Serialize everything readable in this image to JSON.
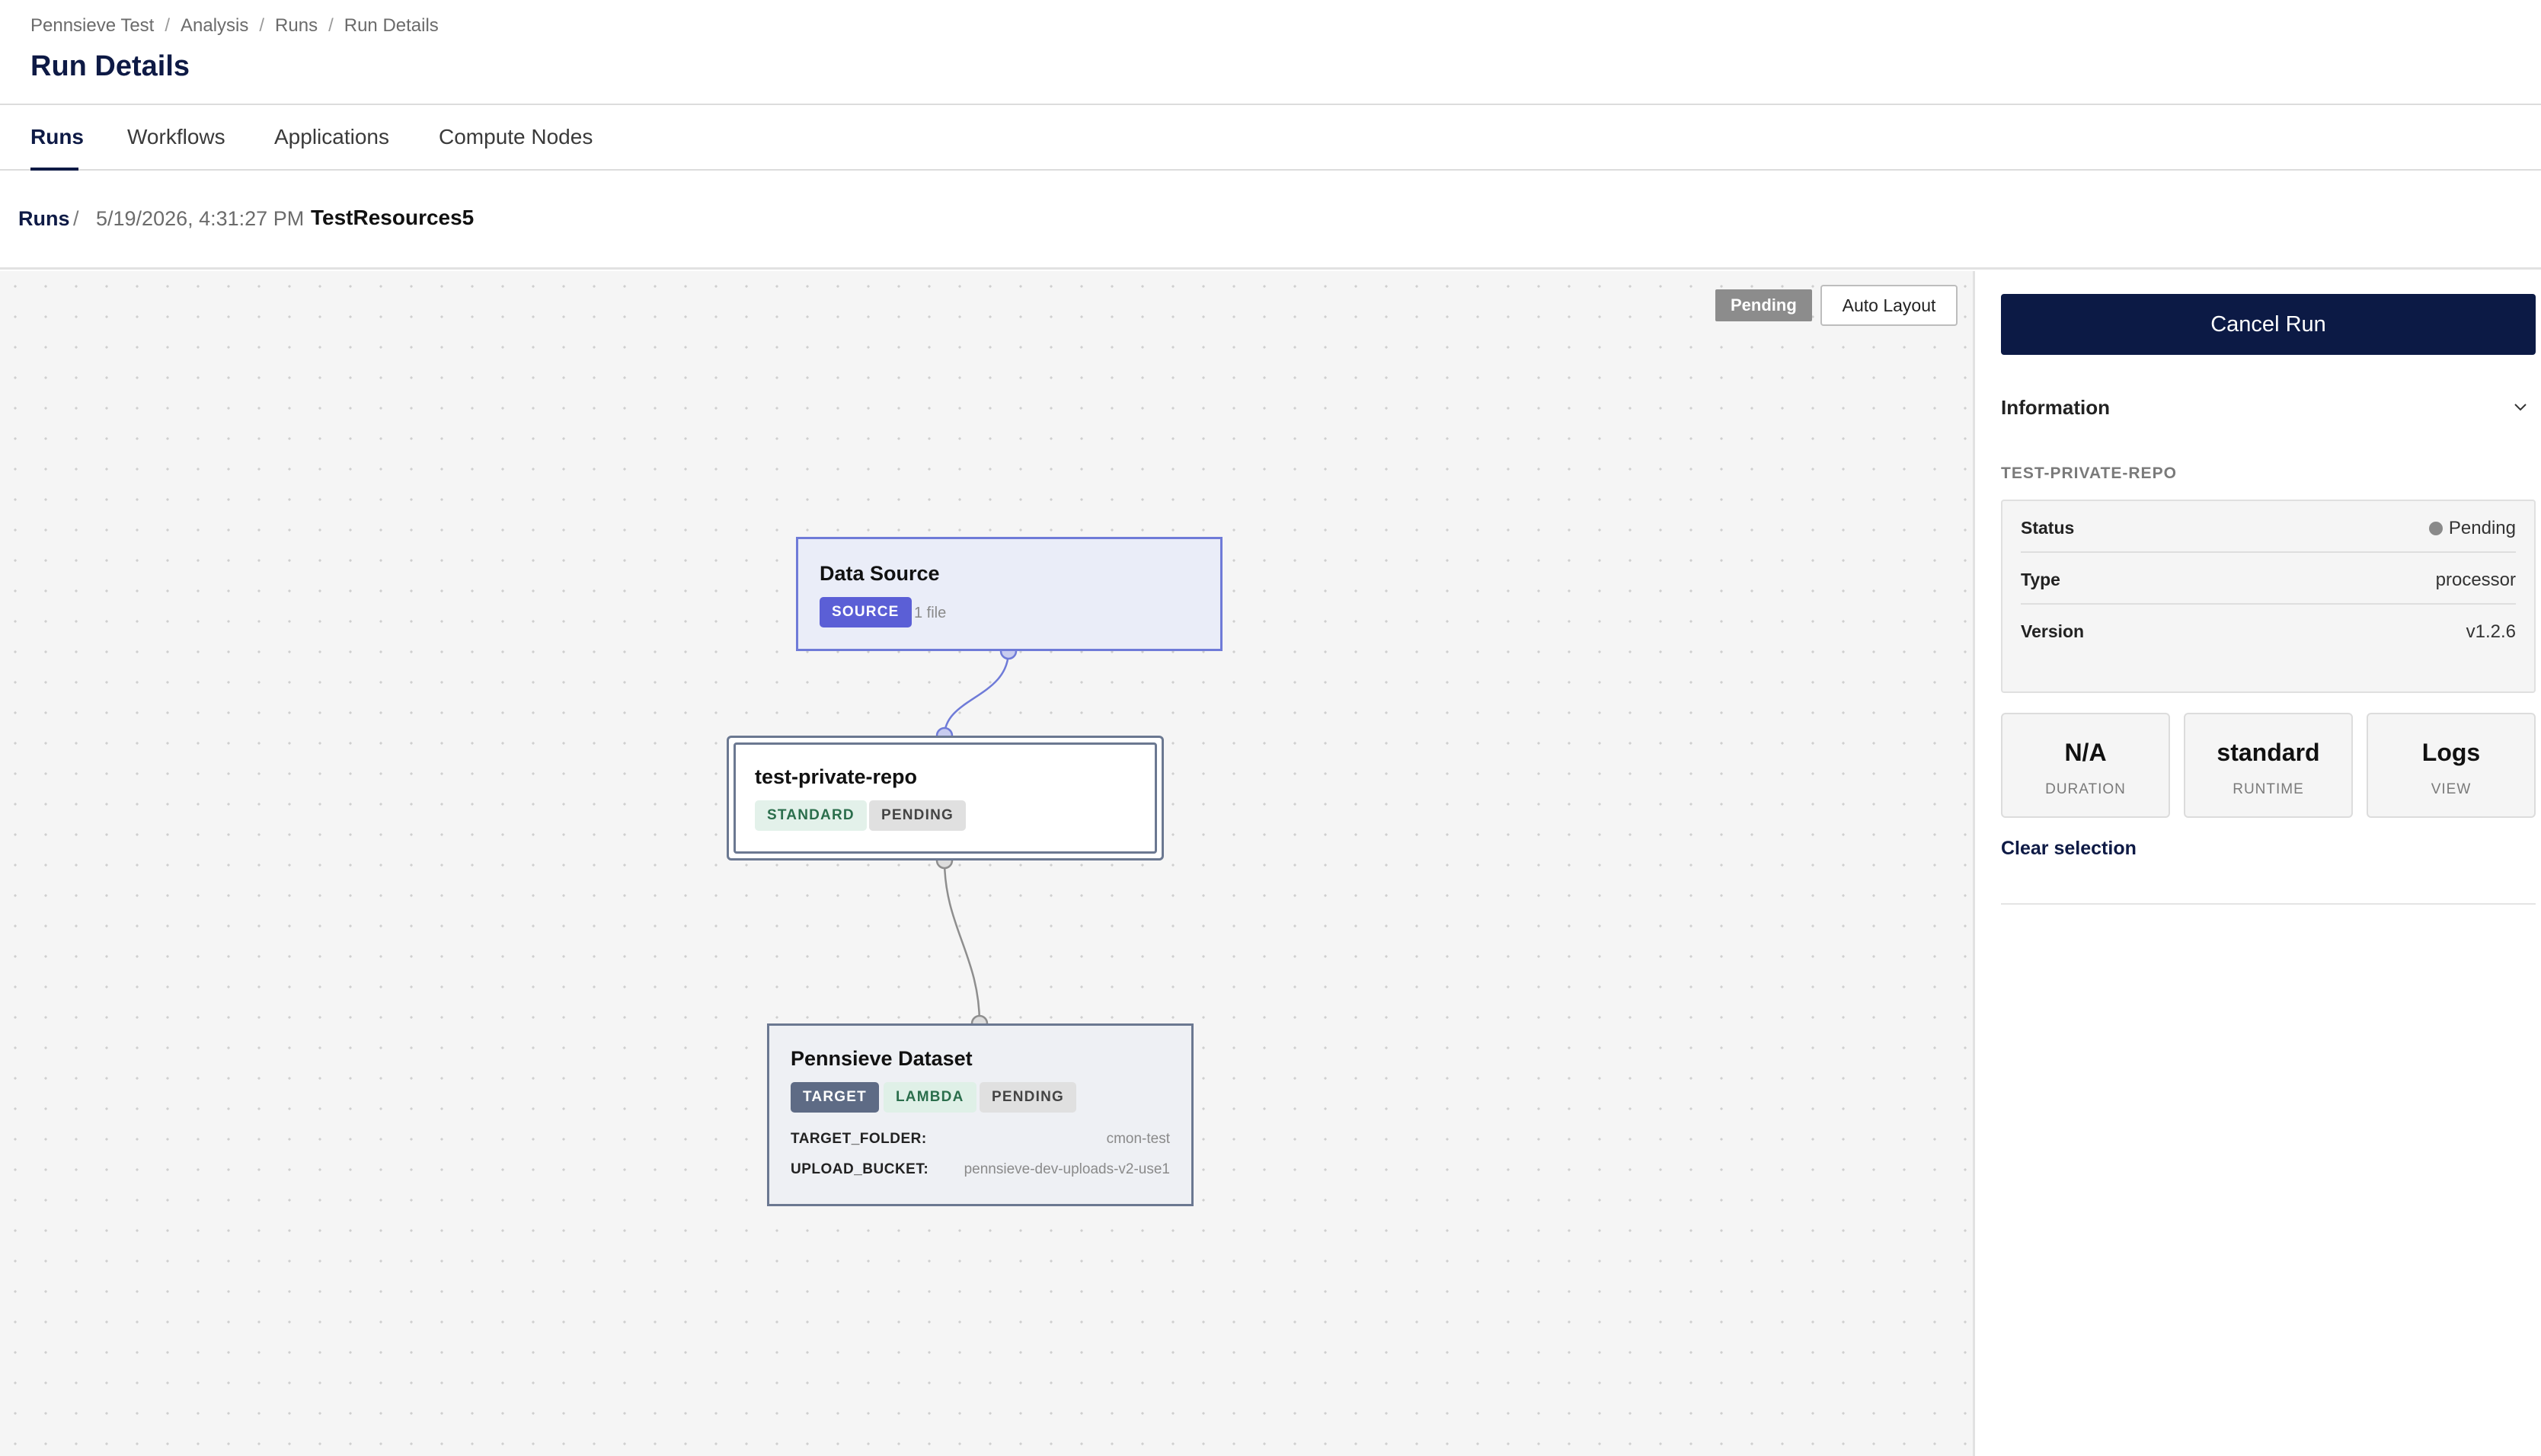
{
  "header": {
    "breadcrumb": [
      "Pennsieve Test",
      "Analysis",
      "Runs",
      "Run Details"
    ],
    "separator": "/",
    "title": "Run Details"
  },
  "tabs": [
    {
      "label": "Runs",
      "active": true
    },
    {
      "label": "Workflows",
      "active": false
    },
    {
      "label": "Applications",
      "active": false
    },
    {
      "label": "Compute Nodes",
      "active": false
    }
  ],
  "run_bar": {
    "runs_link": "Runs",
    "separator": "/",
    "timestamp": "5/19/2026, 4:31:27 PM",
    "name": "TestResources5"
  },
  "canvas": {
    "status_pill": "Pending",
    "auto_layout_label": "Auto Layout",
    "nodes": {
      "data_source": {
        "title": "Data Source",
        "tag": "SOURCE",
        "meta": "1 file"
      },
      "workflow": {
        "title": "test-private-repo",
        "tags": [
          "STANDARD",
          "PENDING"
        ]
      },
      "target": {
        "title": "Pennsieve Dataset",
        "tags": [
          "TARGET",
          "LAMBDA",
          "PENDING"
        ],
        "params": [
          {
            "key": "TARGET_FOLDER:",
            "value": "cmon-test"
          },
          {
            "key": "UPLOAD_BUCKET:",
            "value": "pennsieve-dev-uploads-v2-use1"
          }
        ]
      }
    }
  },
  "panel": {
    "cancel_label": "Cancel Run",
    "info_label": "Information",
    "section_caption": "TEST-PRIVATE-REPO",
    "details": [
      {
        "key": "Status",
        "value": "Pending"
      },
      {
        "key": "Type",
        "value": "processor"
      },
      {
        "key": "Version",
        "value": "v1.2.6"
      }
    ],
    "stats": [
      {
        "value": "N/A",
        "label": "DURATION"
      },
      {
        "value": "standard",
        "label": "RUNTIME"
      },
      {
        "value": "Logs",
        "label": "VIEW"
      }
    ],
    "clear_label": "Clear selection"
  },
  "colors": {
    "primary_navy": "#0c1a45",
    "source_tag": "#5b5fd6",
    "standard_tag_bg": "#e3f1ea",
    "pending_tag_bg": "#e0e0e0",
    "target_tag_bg": "#5e6b85"
  }
}
